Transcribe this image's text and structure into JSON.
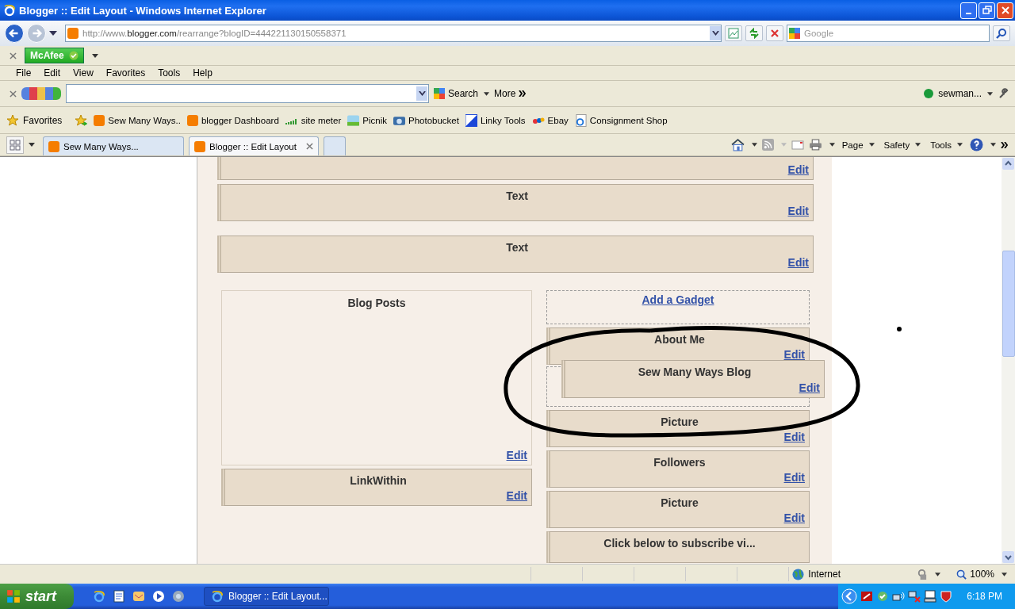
{
  "window": {
    "title": "Blogger :: Edit Layout - Windows Internet Explorer"
  },
  "address_bar": {
    "prefix": "http://www.",
    "domain": "blogger.com",
    "path": "/rearrange?blogID=444221130150558371"
  },
  "search": {
    "placeholder": "Google"
  },
  "mcafee": {
    "label": "McAfee"
  },
  "menu": [
    "File",
    "Edit",
    "View",
    "Favorites",
    "Tools",
    "Help"
  ],
  "google_toolbar": {
    "search_label": "Search",
    "more": "More",
    "account": "sewman..."
  },
  "favorites": {
    "label": "Favorites",
    "links": [
      {
        "label": "Sew Many Ways..",
        "kind": "blogger"
      },
      {
        "label": "blogger Dashboard",
        "kind": "blogger"
      },
      {
        "label": "site meter",
        "kind": "meter"
      },
      {
        "label": "Picnik",
        "kind": "landscape"
      },
      {
        "label": "Photobucket",
        "kind": "camera"
      },
      {
        "label": "Linky Tools",
        "kind": "linky"
      },
      {
        "label": "Ebay",
        "kind": "ebay"
      },
      {
        "label": "Consignment Shop",
        "kind": "ie"
      }
    ]
  },
  "tabs": [
    {
      "label": "Sew Many Ways...",
      "selected": false
    },
    {
      "label": "Blogger :: Edit Layout",
      "selected": true
    }
  ],
  "command_bar": [
    "Page",
    "Safety",
    "Tools"
  ],
  "layout": {
    "top_widgets": [
      {
        "edit": "Edit"
      },
      {
        "title": "Text",
        "edit": "Edit"
      },
      {
        "title": "Text",
        "edit": "Edit"
      }
    ],
    "main": [
      {
        "kind": "posts",
        "title": "Blog Posts",
        "edit": "Edit"
      },
      {
        "kind": "widget",
        "title": "LinkWithin",
        "edit": "Edit"
      }
    ],
    "add_gadget": "Add a Gadget",
    "sidebar": [
      {
        "kind": "widget",
        "title": "About Me",
        "edit": "Edit"
      },
      {
        "kind": "placeholder"
      },
      {
        "kind": "widget",
        "title": "Picture",
        "edit": "Edit"
      },
      {
        "kind": "widget",
        "title": "Followers",
        "edit": "Edit"
      },
      {
        "kind": "widget",
        "title": "Picture",
        "edit": "Edit"
      },
      {
        "kind": "cut",
        "title": "Click below to subscribe vi..."
      }
    ],
    "dragging": {
      "title": "Sew Many Ways Blog",
      "edit": "Edit"
    }
  },
  "status_bar": {
    "zone": "Internet",
    "zoom": "100%"
  },
  "taskbar": {
    "start": "start",
    "windows": [
      {
        "label": "Blogger :: Edit Layout..."
      }
    ],
    "clock": "6:18 PM"
  }
}
